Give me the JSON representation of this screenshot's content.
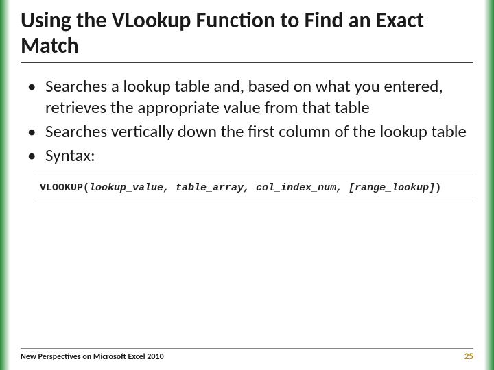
{
  "title": "Using the VLookup Function to Find an Exact Match",
  "bullets": [
    "Searches a lookup table and, based on what you entered, retrieves the appropriate value from that table",
    "Searches vertically down the first column of the lookup table",
    "Syntax:"
  ],
  "syntax": {
    "fn": "VLOOKUP(",
    "args": "lookup_value, table_array, col_index_num, [range_lookup]",
    "close": ")"
  },
  "footer": {
    "source": "New Perspectives on Microsoft Excel 2010",
    "page": "25"
  }
}
